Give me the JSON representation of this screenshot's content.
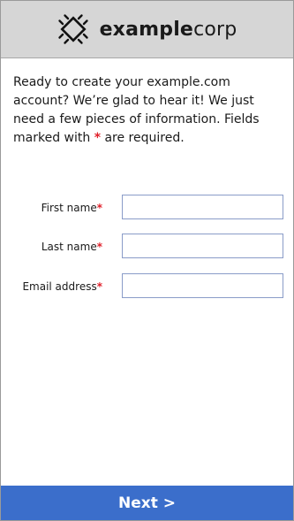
{
  "header": {
    "brand_bold": "example",
    "brand_light": "corp",
    "logo_icon": "circuit-chip-icon"
  },
  "intro": {
    "text": "Ready to create your example.com account? We’re glad to hear it! We just need a few pieces of information. Fields marked with",
    "required_marker": "*",
    "text_end": "are required."
  },
  "form": {
    "fields": [
      {
        "label": "First name",
        "required_marker": "*",
        "value": "",
        "placeholder": ""
      },
      {
        "label": "Last name",
        "required_marker": "*",
        "value": "",
        "placeholder": ""
      },
      {
        "label": "Email address",
        "required_marker": "*",
        "value": "",
        "placeholder": ""
      }
    ]
  },
  "footer": {
    "next_label": "Next >"
  },
  "colors": {
    "header_bg": "#d6d6d6",
    "required": "#e0202a",
    "input_border": "#8a9cc8",
    "next_bg": "#3b6ecb",
    "next_text": "#ffffff"
  }
}
